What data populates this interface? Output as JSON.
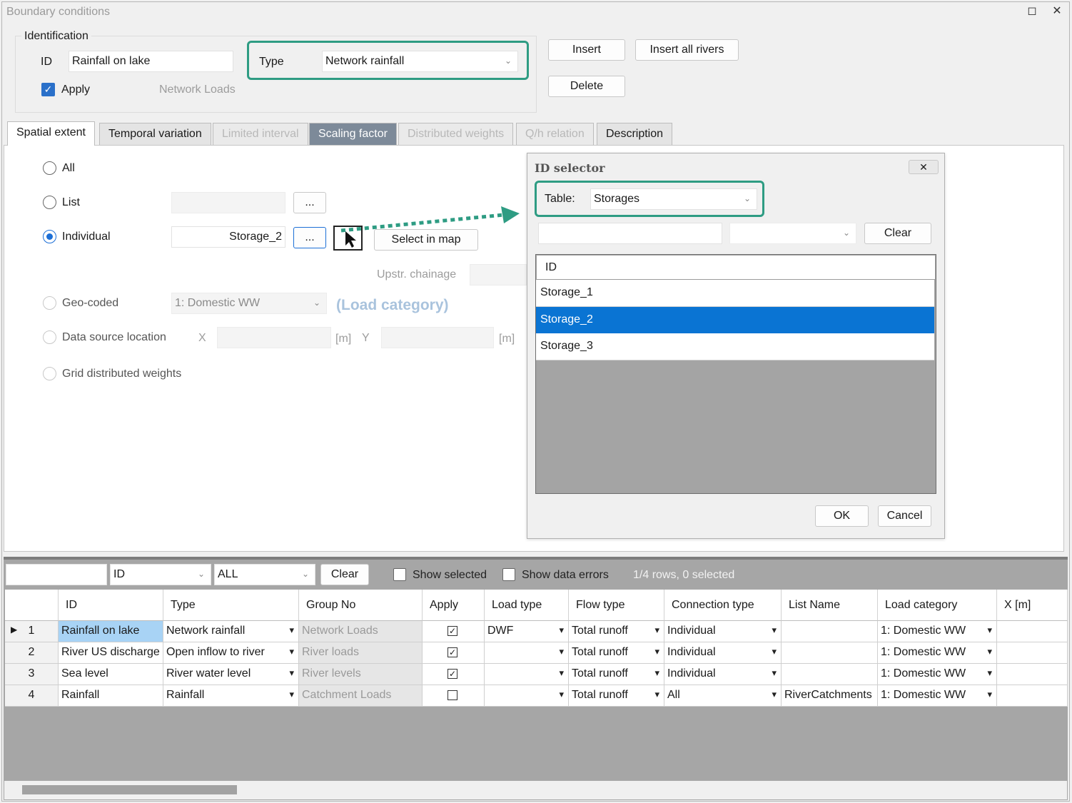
{
  "window": {
    "title": "Boundary conditions"
  },
  "identification": {
    "group_label": "Identification",
    "id_label": "ID",
    "id_value": "Rainfall on lake",
    "type_label": "Type",
    "type_value": "Network rainfall",
    "apply_label": "Apply",
    "apply_checked": true,
    "group_value": "Network Loads"
  },
  "actions": {
    "insert": "Insert",
    "insert_all_rivers": "Insert all rivers",
    "delete": "Delete"
  },
  "tabs": [
    {
      "label": "Spatial extent",
      "state": "active"
    },
    {
      "label": "Temporal variation",
      "state": "normal"
    },
    {
      "label": "Limited interval",
      "state": "disabled"
    },
    {
      "label": "Scaling factor",
      "state": "dark"
    },
    {
      "label": "Distributed weights",
      "state": "disabled"
    },
    {
      "label": "Q/h relation",
      "state": "disabled"
    },
    {
      "label": "Description",
      "state": "normal"
    }
  ],
  "spatial": {
    "all_label": "All",
    "list_label": "List",
    "individual_label": "Individual",
    "individual_value": "Storage_2",
    "ellipsis": "...",
    "select_in_map": "Select in map",
    "upstr_chainage": "Upstr. chainage",
    "geo_coded_label": "Geo-coded",
    "geo_coded_value": "1: Domestic WW",
    "load_category": "(Load category)",
    "data_source_label": "Data source location",
    "x_label": "X",
    "y_label": "Y",
    "unit_m": "[m]",
    "grid_weights_label": "Grid distributed weights"
  },
  "id_selector": {
    "title": "ID selector",
    "table_label": "Table:",
    "table_value": "Storages",
    "clear": "Clear",
    "column": "ID",
    "rows": [
      "Storage_1",
      "Storage_2",
      "Storage_3"
    ],
    "selected_index": 1,
    "ok": "OK",
    "cancel": "Cancel"
  },
  "filter_bar": {
    "field_value": "ID",
    "all_value": "ALL",
    "clear": "Clear",
    "show_selected": "Show selected",
    "show_errors": "Show data errors",
    "status": "1/4 rows, 0 selected"
  },
  "table": {
    "columns": [
      "ID",
      "Type",
      "Group No",
      "Apply",
      "Load type",
      "Flow type",
      "Connection type",
      "List Name",
      "Load category",
      "X [m]"
    ],
    "rows": [
      {
        "n": "1",
        "id": "Rainfall on lake",
        "type": "Network rainfall",
        "group": "Network Loads",
        "apply": true,
        "load": "DWF",
        "flow": "Total runoff",
        "conn": "Individual",
        "list": "",
        "cat": "1: Domestic WW"
      },
      {
        "n": "2",
        "id": "River US discharge",
        "type": "Open inflow to river",
        "group": "River loads",
        "apply": true,
        "load": "",
        "flow": "Total runoff",
        "conn": "Individual",
        "list": "",
        "cat": "1: Domestic WW"
      },
      {
        "n": "3",
        "id": "Sea level",
        "type": "River water level",
        "group": "River levels",
        "apply": true,
        "load": "",
        "flow": "Total runoff",
        "conn": "Individual",
        "list": "",
        "cat": "1: Domestic WW"
      },
      {
        "n": "4",
        "id": "Rainfall",
        "type": "Rainfall",
        "group": "Catchment Loads",
        "apply": false,
        "load": "",
        "flow": "Total runoff",
        "conn": "All",
        "list": "RiverCatchments",
        "cat": "1: Domestic WW"
      }
    ]
  },
  "colors": {
    "highlight": "#2e9c83",
    "selection": "#0a74d3",
    "active_cell": "#a8d3f5"
  }
}
